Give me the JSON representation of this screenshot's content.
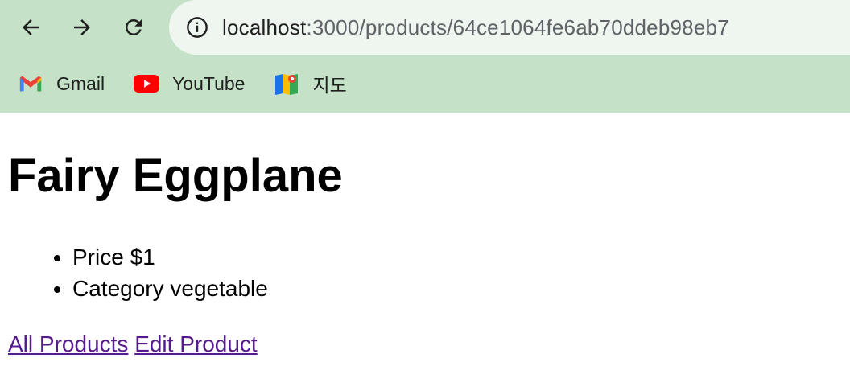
{
  "browser": {
    "url_host": "localhost",
    "url_path": ":3000/products/64ce1064fe6ab70ddeb98eb7",
    "bookmarks": [
      {
        "label": "Gmail",
        "icon": "gmail-icon"
      },
      {
        "label": "YouTube",
        "icon": "youtube-icon"
      },
      {
        "label": "지도",
        "icon": "maps-icon"
      }
    ],
    "colors": {
      "toolbar": "#c5e2c8",
      "omnibox": "#eef6ef",
      "link_visited": "#551a8b"
    }
  },
  "product": {
    "name": "Fairy Eggplane",
    "details": [
      "Price $1",
      "Category vegetable"
    ]
  },
  "links": {
    "all_products": "All Products",
    "edit_product": "Edit Product"
  }
}
